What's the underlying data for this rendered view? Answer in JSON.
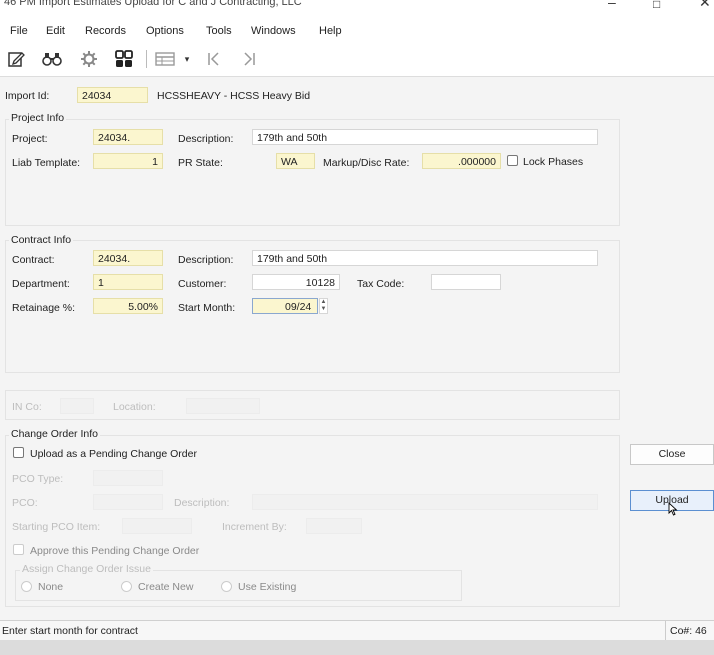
{
  "window": {
    "title": "46 PM Import Estimates Upload for C and J Contracting, LLC"
  },
  "menu": [
    "File",
    "Edit",
    "Records",
    "Options",
    "Tools",
    "Windows",
    "Help"
  ],
  "toolbar": {
    "icons": [
      "edit-icon",
      "binoculars-icon",
      "gear-icon",
      "grid-icon",
      "table-icon",
      "first-record-icon",
      "last-record-icon"
    ]
  },
  "import": {
    "label": "Import Id:",
    "value": "24034",
    "source": "HCSSHEAVY - HCSS Heavy Bid"
  },
  "project_info": {
    "title": "Project Info",
    "project_label": "Project:",
    "project": "24034.",
    "desc_label": "Description:",
    "description": "179th and 50th",
    "liab_label": "Liab Template:",
    "liab": "1",
    "prstate_label": "PR State:",
    "prstate": "WA",
    "markup_label": "Markup/Disc Rate:",
    "markup": ".000000",
    "lock_label": "Lock Phases"
  },
  "contract_info": {
    "title": "Contract Info",
    "contract_label": "Contract:",
    "contract": "24034.",
    "desc_label": "Description:",
    "description": "179th and 50th",
    "dept_label": "Department:",
    "dept": "1",
    "customer_label": "Customer:",
    "customer": "10128",
    "taxcode_label": "Tax Code:",
    "taxcode": "",
    "retainage_label": "Retainage %:",
    "retainage": "5.00%",
    "startmonth_label": "Start Month:",
    "startmonth": "09/24"
  },
  "in_section": {
    "inco_label": "IN Co:",
    "location_label": "Location:"
  },
  "change_order": {
    "title": "Change Order Info",
    "upload_pending_label": "Upload as a Pending Change Order",
    "pco_type_label": "PCO Type:",
    "pco_label": "PCO:",
    "pco_desc_label": "Description:",
    "starting_item_label": "Starting PCO Item:",
    "increment_label": "Increment By:",
    "approve_label": "Approve this Pending Change Order",
    "assign_title": "Assign Change Order Issue",
    "options": [
      "None",
      "Create New",
      "Use Existing"
    ]
  },
  "buttons": {
    "close": "Close",
    "upload": "Upload"
  },
  "status": {
    "message": "Enter start month for contract",
    "company": "Co#: 46"
  }
}
